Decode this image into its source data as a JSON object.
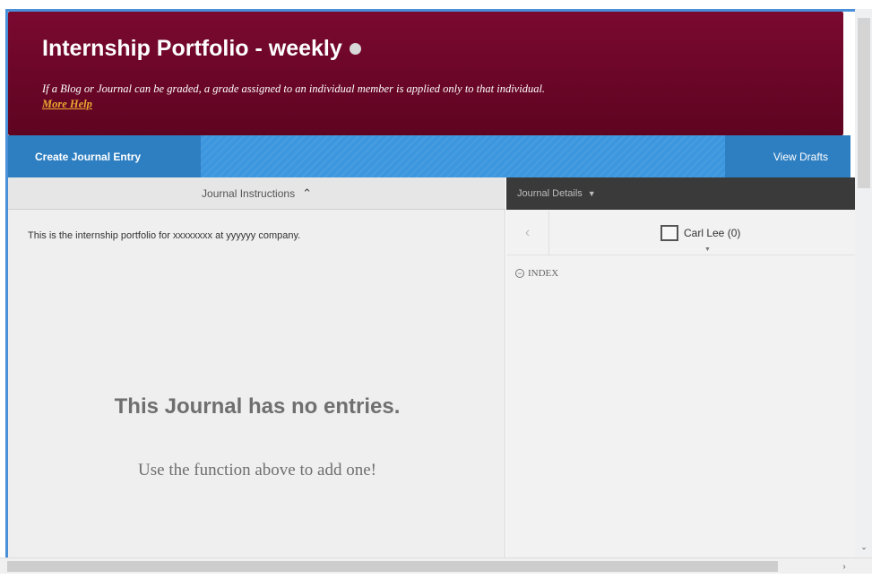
{
  "header": {
    "title": "Internship Portfolio - weekly",
    "description": "If a Blog or Journal can be graded, a grade assigned to an individual member is applied only to that individual.",
    "more_help": "More Help"
  },
  "toolbar": {
    "create_label": "Create Journal Entry",
    "drafts_label": "View Drafts"
  },
  "instructions": {
    "header_label": "Journal Instructions",
    "text": "This is the internship portfolio for xxxxxxxx at yyyyyy company."
  },
  "empty_state": {
    "title": "This Journal has no entries.",
    "subtitle": "Use the function above to add one!"
  },
  "details": {
    "header_label": "Journal Details",
    "member_label": "Carl Lee (0)",
    "index_label": "INDEX"
  },
  "colors": {
    "header_bg": "#6b0628",
    "toolbar_bg": "#3d97de",
    "more_help": "#e9a830",
    "details_bar": "#3a3a3a"
  }
}
